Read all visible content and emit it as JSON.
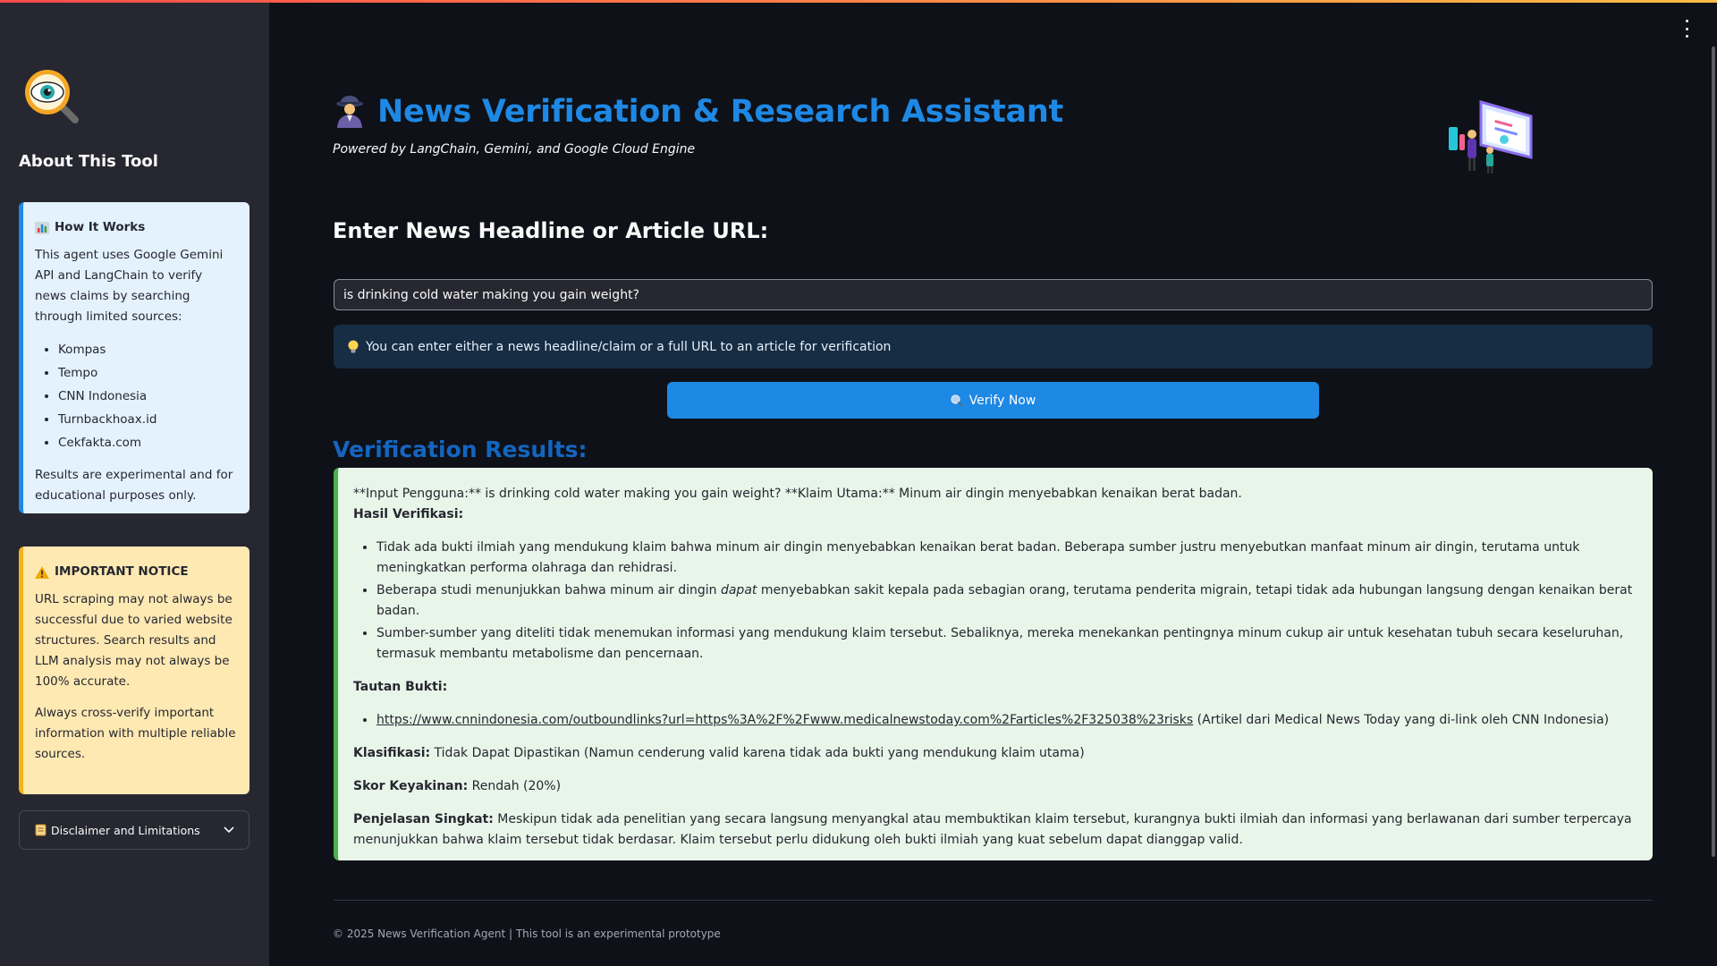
{
  "sidebar": {
    "about_title": "About This Tool",
    "how": {
      "icon": "bar-chart-icon",
      "title": "How It Works",
      "intro": "This agent uses Google Gemini API and LangChain to verify news claims by searching through limited sources:",
      "sources": [
        "Kompas",
        "Tempo",
        "CNN Indonesia",
        "Turnbackhoax.id",
        "Cekfakta.com"
      ],
      "note": "Results are experimental and for educational purposes only."
    },
    "notice": {
      "icon": "warning-icon",
      "title": "IMPORTANT NOTICE",
      "text1": "URL scraping may not always be successful due to varied website structures. Search results and LLM analysis may not always be 100% accurate.",
      "text2": "Always cross-verify important information with multiple reliable sources."
    },
    "disclaimer_label": "Disclaimer and Limitations"
  },
  "header": {
    "title": "News Verification & Research Assistant",
    "subtitle": "Powered by LangChain, Gemini, and Google Cloud Engine"
  },
  "input": {
    "heading": "Enter News Headline or Article URL:",
    "value": "is drinking cold water making you gain weight?",
    "hint": "You can enter either a news headline/claim or a full URL to an article for verification",
    "button_label": "Verify Now"
  },
  "results": {
    "heading": "Verification Results:",
    "first_line": "**Input Pengguna:** is drinking cold water making you gain weight? **Klaim Utama:** Minum air dingin menyebabkan kenaikan berat badan.",
    "hasil_label": "Hasil Verifikasi:",
    "bullet1": "Tidak ada bukti ilmiah yang mendukung klaim bahwa minum air dingin menyebabkan kenaikan berat badan. Beberapa sumber justru menyebutkan manfaat minum air dingin, terutama untuk meningkatkan performa olahraga dan rehidrasi.",
    "bullet2_pre": "Beberapa studi menunjukkan bahwa minum air dingin ",
    "bullet2_em": "dapat",
    "bullet2_post": " menyebabkan sakit kepala pada sebagian orang, terutama penderita migrain, tetapi tidak ada hubungan langsung dengan kenaikan berat badan.",
    "bullet3": "Sumber-sumber yang diteliti tidak menemukan informasi yang mendukung klaim tersebut. Sebaliknya, mereka menekankan pentingnya minum cukup air untuk kesehatan tubuh secara keseluruhan, termasuk membantu metabolisme dan pencernaan.",
    "tautan_label": "Tautan Bukti:",
    "link_url": "https://www.cnnindonesia.com/outboundlinks?url=https%3A%2F%2Fwww.medicalnewstoday.com%2Farticles%2F325038%23risks",
    "link_note": " (Artikel dari Medical News Today yang di-link oleh CNN Indonesia)",
    "klasifikasi_label": "Klasifikasi:",
    "klasifikasi_value": " Tidak Dapat Dipastikan (Namun cenderung valid karena tidak ada bukti yang mendukung klaim utama)",
    "skor_label": "Skor Keyakinan:",
    "skor_value": " Rendah (20%)",
    "penjelasan_label": "Penjelasan Singkat:",
    "penjelasan_value": " Meskipun tidak ada penelitian yang secara langsung menyangkal atau membuktikan klaim tersebut, kurangnya bukti ilmiah dan informasi yang berlawanan dari sumber terpercaya menunjukkan bahwa klaim tersebut tidak berdasar. Klaim tersebut perlu didukung oleh bukti ilmiah yang kuat sebelum dapat dianggap valid."
  },
  "footer": {
    "text": "© 2025 News Verification Agent | This tool is an experimental prototype"
  },
  "colors": {
    "accent": "#1e88e5",
    "result_border": "#4caf50",
    "result_bg": "#e8f5e9",
    "notice_bg": "#ffe9b3",
    "how_bg": "#e3f2fd"
  }
}
